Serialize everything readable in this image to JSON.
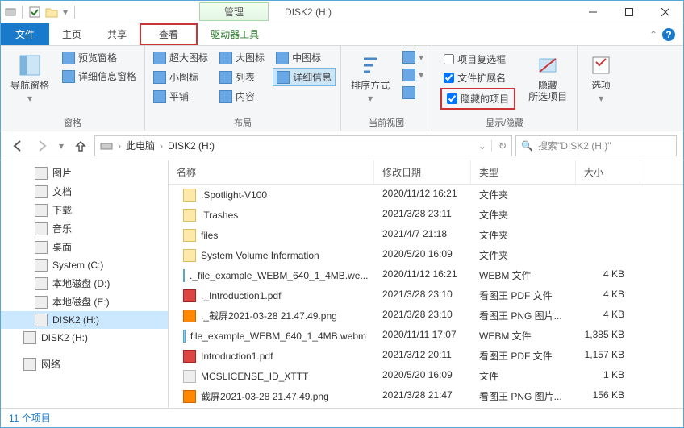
{
  "window": {
    "title": "DISK2 (H:)",
    "context_tab": "管理"
  },
  "tabs": {
    "file": "文件",
    "home": "主页",
    "share": "共享",
    "view": "查看",
    "drive": "驱动器工具"
  },
  "ribbon": {
    "panes": "窗格",
    "nav_pane": "导航窗格",
    "preview_pane": "预览窗格",
    "details_pane": "详细信息窗格",
    "layout": "布局",
    "xl_icons": "超大图标",
    "l_icons": "大图标",
    "m_icons": "中图标",
    "s_icons": "小图标",
    "list": "列表",
    "details": "详细信息",
    "tiles": "平铺",
    "content": "内容",
    "current_view": "当前视图",
    "sort_by": "排序方式",
    "show_hide": "显示/隐藏",
    "item_checkboxes": "项目复选框",
    "file_ext": "文件扩展名",
    "hidden_items": "隐藏的项目",
    "hide_selected": "隐藏\n所选项目",
    "options": "选项"
  },
  "address": {
    "root": "此电脑",
    "drive": "DISK2 (H:)"
  },
  "search": {
    "placeholder": "搜索\"DISK2 (H:)\""
  },
  "tree": [
    {
      "label": "图片",
      "icon": "pic"
    },
    {
      "label": "文档",
      "icon": "doc"
    },
    {
      "label": "下载",
      "icon": "down"
    },
    {
      "label": "音乐",
      "icon": "music"
    },
    {
      "label": "桌面",
      "icon": "desk"
    },
    {
      "label": "System (C:)",
      "icon": "drv"
    },
    {
      "label": "本地磁盘 (D:)",
      "icon": "drv"
    },
    {
      "label": "本地磁盘 (E:)",
      "icon": "drv"
    },
    {
      "label": "DISK2 (H:)",
      "icon": "drv",
      "selected": true
    },
    {
      "label": "DISK2 (H:)",
      "icon": "drv",
      "lvl": 1
    },
    {
      "label": "网络",
      "icon": "net",
      "lvl": 1,
      "gap": true
    }
  ],
  "columns": {
    "name": "名称",
    "modified": "修改日期",
    "type": "类型",
    "size": "大小"
  },
  "files": [
    {
      "name": ".Spotlight-V100",
      "modified": "2020/11/12 16:21",
      "type": "文件夹",
      "size": "",
      "icon": "folder"
    },
    {
      "name": ".Trashes",
      "modified": "2021/3/28 23:11",
      "type": "文件夹",
      "size": "",
      "icon": "folder"
    },
    {
      "name": "files",
      "modified": "2021/4/7 21:18",
      "type": "文件夹",
      "size": "",
      "icon": "folder"
    },
    {
      "name": "System Volume Information",
      "modified": "2020/5/20 16:09",
      "type": "文件夹",
      "size": "",
      "icon": "folder"
    },
    {
      "name": "._file_example_WEBM_640_1_4MB.we...",
      "modified": "2020/11/12 16:21",
      "type": "WEBM 文件",
      "size": "4 KB",
      "icon": "web"
    },
    {
      "name": "._Introduction1.pdf",
      "modified": "2021/3/28 23:10",
      "type": "看图王 PDF 文件",
      "size": "4 KB",
      "icon": "pdf"
    },
    {
      "name": "._截屏2021-03-28 21.47.49.png",
      "modified": "2021/3/28 23:10",
      "type": "看图王 PNG 图片...",
      "size": "4 KB",
      "icon": "png"
    },
    {
      "name": "file_example_WEBM_640_1_4MB.webm",
      "modified": "2020/11/11 17:07",
      "type": "WEBM 文件",
      "size": "1,385 KB",
      "icon": "web"
    },
    {
      "name": "Introduction1.pdf",
      "modified": "2021/3/12 20:11",
      "type": "看图王 PDF 文件",
      "size": "1,157 KB",
      "icon": "pdf"
    },
    {
      "name": "MCSLICENSE_ID_XTTT",
      "modified": "2020/5/20 16:09",
      "type": "文件",
      "size": "1 KB",
      "icon": "txt"
    },
    {
      "name": "截屏2021-03-28 21.47.49.png",
      "modified": "2021/3/28 21:47",
      "type": "看图王 PNG 图片...",
      "size": "156 KB",
      "icon": "png"
    }
  ],
  "status": {
    "count": "11 个项目"
  }
}
